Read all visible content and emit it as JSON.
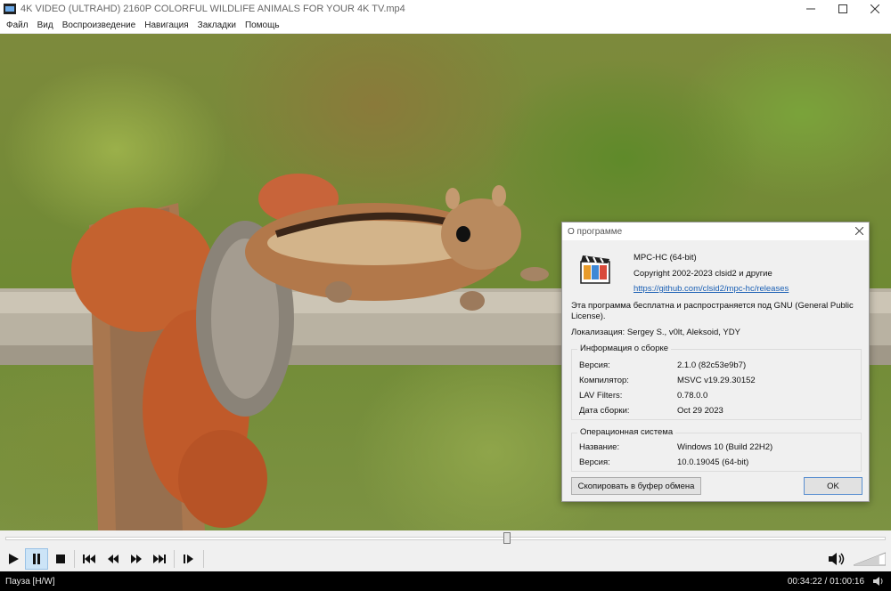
{
  "window": {
    "title": "4K VIDEO (ULTRAHD) 2160P COLORFUL WILDLIFE ANIMALS FOR YOUR 4K TV.mp4"
  },
  "menu": [
    "Файл",
    "Вид",
    "Воспроизведение",
    "Навигация",
    "Закладки",
    "Помощь"
  ],
  "about": {
    "title": "О программе",
    "product": "MPC-HC (64-bit)",
    "copyright": "Copyright 2002-2023 clsid2 и другие",
    "link": "https://github.com/clsid2/mpc-hc/releases",
    "license": "Эта программа бесплатна и распространяется под GNU (General Public License).",
    "localization": "Локализация: Sergey S., v0lt, Aleksoid, YDY",
    "build": {
      "heading": "Информация о сборке",
      "rows": [
        {
          "label": "Версия:",
          "value": "2.1.0 (82c53e9b7)"
        },
        {
          "label": "Компилятор:",
          "value": "MSVC v19.29.30152"
        },
        {
          "label": "LAV Filters:",
          "value": "0.78.0.0"
        },
        {
          "label": "Дата сборки:",
          "value": "Oct 29 2023"
        }
      ]
    },
    "os": {
      "heading": "Операционная система",
      "rows": [
        {
          "label": "Название:",
          "value": "Windows 10 (Build 22H2)"
        },
        {
          "label": "Версия:",
          "value": "10.0.19045 (64-bit)"
        }
      ]
    },
    "copy_button": "Скопировать в буфер обмена",
    "ok_button": "OK"
  },
  "seek": {
    "position_fraction": 0.57
  },
  "volume": {
    "level_fraction": 0.8
  },
  "status": {
    "state": "Пауза [H/W]",
    "time": "00:34:22 / 01:00:16"
  },
  "colors": {
    "accent": "#cce4f7",
    "link": "#1a5fb4"
  }
}
